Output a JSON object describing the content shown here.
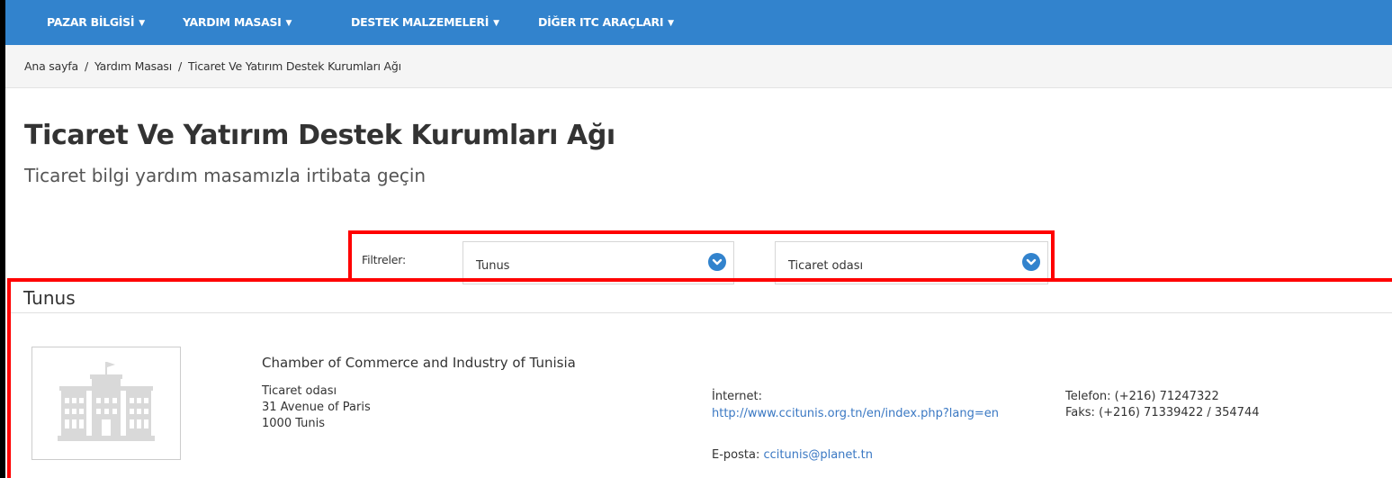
{
  "nav": {
    "items": [
      {
        "label": "PAZAR BİLGİSİ"
      },
      {
        "label": "YARDIM MASASI"
      },
      {
        "label": "DESTEK MALZEMELERİ"
      },
      {
        "label": "DİĞER ITC ARAÇLARI"
      }
    ],
    "chevron": "⌄"
  },
  "breadcrumb": {
    "items": [
      "Ana sayfa",
      "Yardım Masası",
      "Ticaret Ve Yatırım Destek Kurumları Ağı"
    ],
    "separator": "/"
  },
  "page": {
    "title": "Ticaret Ve Yatırım Destek Kurumları Ağı",
    "subtitle": "Ticaret bilgi yardım masamızla irtibata geçin"
  },
  "filters": {
    "label": "Filtreler:",
    "country": "Tunus",
    "type": "Ticaret odası"
  },
  "results": {
    "section_title": "Tunus",
    "organization": {
      "name": "Chamber of Commerce and Industry of Tunisia",
      "type": "Ticaret odası",
      "street": "31 Avenue of Paris",
      "city": "1000 Tunis",
      "internet_label": "İnternet:",
      "internet_url": "http://www.ccitunis.org.tn/en/index.php?lang=en",
      "email_label": "E-posta:",
      "email": "ccitunis@planet.tn",
      "phone": "Telefon: (+216) 71247322",
      "fax": "Faks: (+216) 71339422 / 354744",
      "image_icon": "building-icon"
    }
  },
  "colors": {
    "nav_bg": "#3283cd",
    "link": "#3a78c3",
    "highlight": "#ff0000"
  }
}
